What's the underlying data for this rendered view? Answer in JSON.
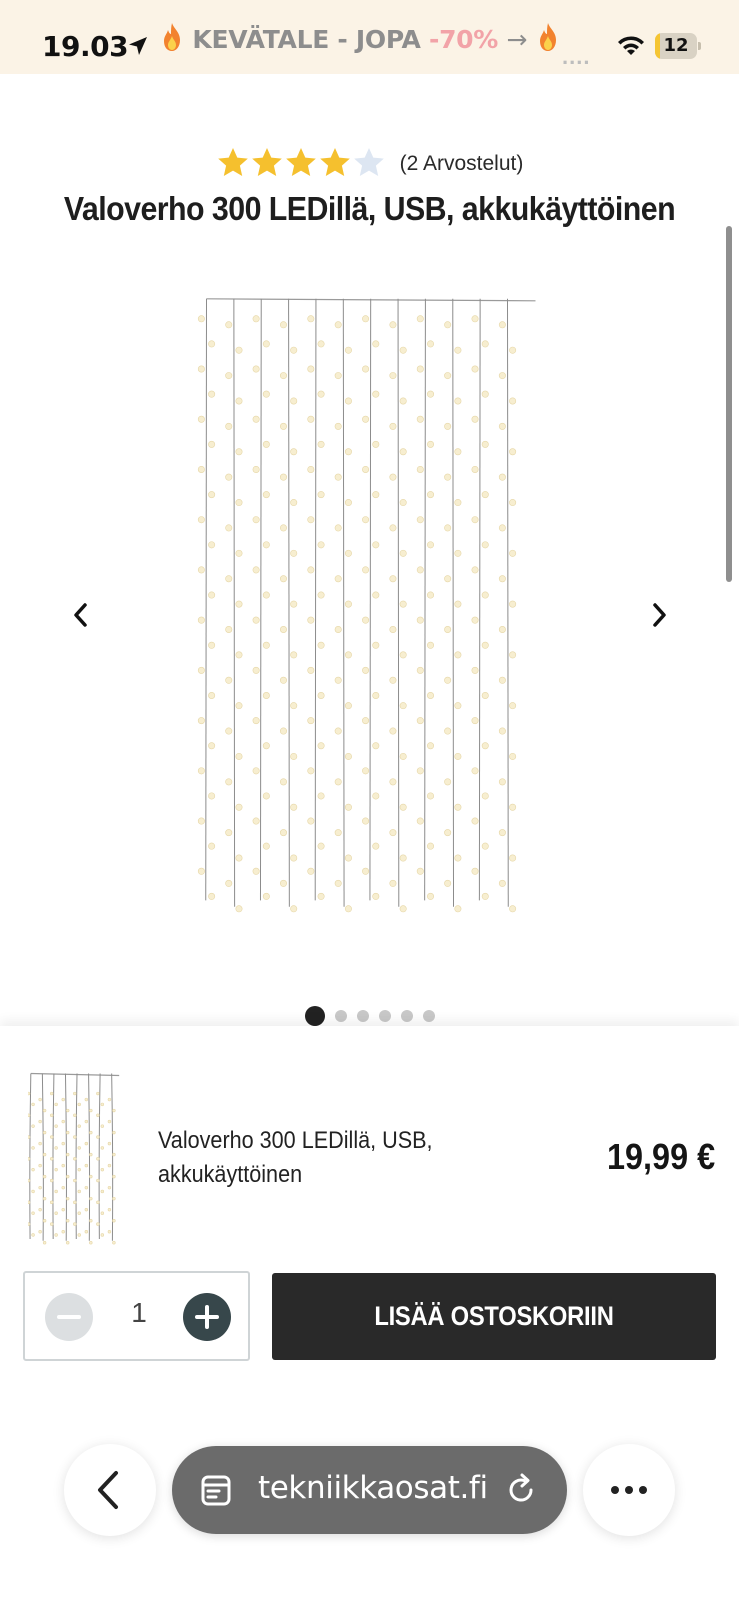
{
  "status_bar": {
    "time": "19.03",
    "banner_text": "KEVÄTALE - JOPA",
    "banner_discount": "-70%",
    "banner_arrow": "→",
    "dots": "....",
    "battery_level": "12",
    "battery_fill_fraction": 0.12,
    "icons": [
      "location-arrow-icon",
      "flame-icon",
      "wifi-icon",
      "battery-icon"
    ]
  },
  "product": {
    "rating_value": 4,
    "rating_max": 5,
    "rating_text": "(2 Arvostelut)",
    "title": "Valoverho 300 LEDillä, USB, akkukäyttöinen"
  },
  "gallery": {
    "image_count": 6,
    "active_index": 0,
    "prev_icon": "chevron-left-icon",
    "next_icon": "chevron-right-icon"
  },
  "purchase_sheet": {
    "product_name": "Valoverho 300 LEDillä, USB, akkukäyttöinen",
    "price": "19,99 €",
    "quantity": "1",
    "add_to_cart_label": "LISÄÄ OSTOSKORIIN"
  },
  "browser": {
    "url": "tekniikkaosat.fi",
    "icons": [
      "back-chevron-icon",
      "tabs-icon",
      "reload-icon",
      "more-icon"
    ]
  },
  "colors": {
    "status_bar_bg": "#fbf3e6",
    "star_filled": "#f5c02e",
    "star_empty": "#dde6f2",
    "button_dark": "#292929",
    "plus_button": "#37474b",
    "url_pill": "#6b6b6b"
  }
}
